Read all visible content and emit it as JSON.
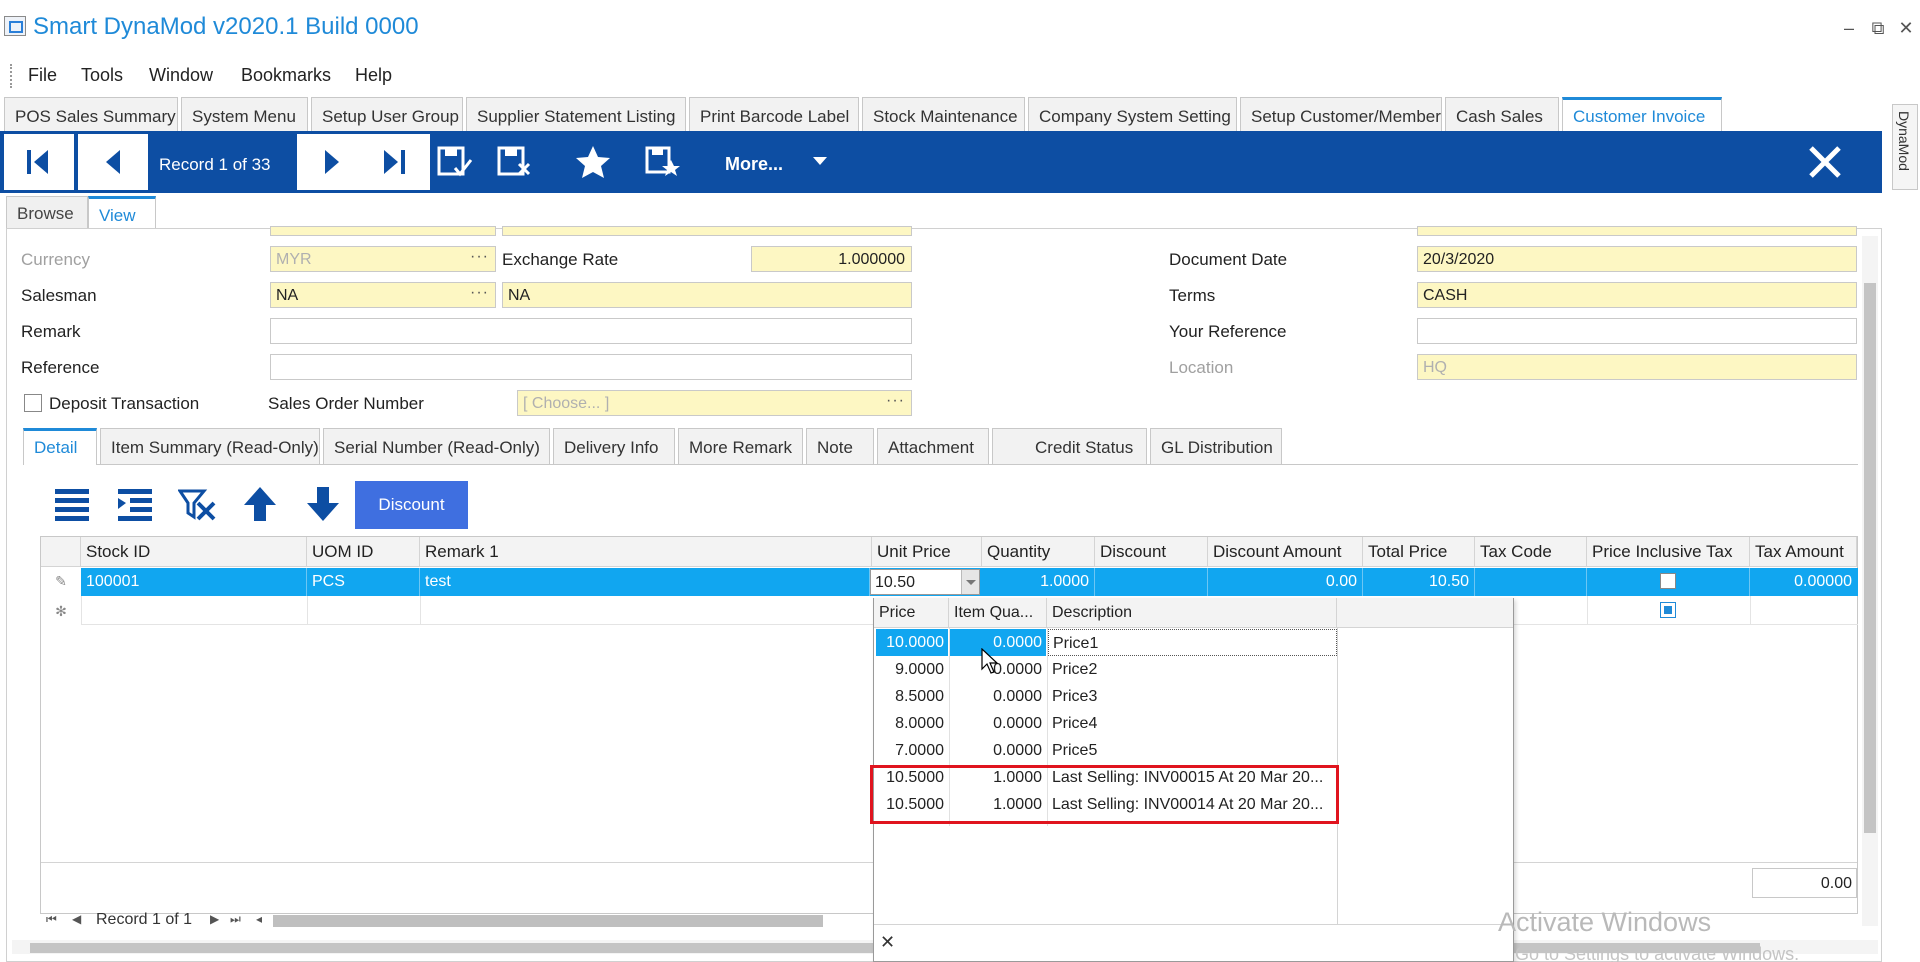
{
  "app": {
    "title": "Smart DynaMod v2020.1 Build 0000"
  },
  "window_controls": {
    "minimize": "–",
    "restore": "⧉",
    "close": "✕"
  },
  "menu": [
    "File",
    "Tools",
    "Window",
    "Bookmarks",
    "Help"
  ],
  "doc_tabs": [
    "POS Sales Summary",
    "System Menu",
    "Setup User Group",
    "Supplier Statement Listing",
    "Print Barcode Label",
    "Stock Maintenance",
    "Company System Setting",
    "Setup Customer/Member",
    "Cash Sales",
    "Customer Invoice"
  ],
  "side_tab": "DynaMod",
  "toolbar": {
    "record_label": "Record 1 of 33",
    "more_label": "More..."
  },
  "view_tabs": [
    "Browse",
    "View"
  ],
  "form": {
    "currency_label": "Currency",
    "currency_value": "MYR",
    "exchange_rate_label": "Exchange Rate",
    "exchange_rate_value": "1.000000",
    "salesman_label": "Salesman",
    "salesman_value": "NA",
    "salesman_name": "NA",
    "remark_label": "Remark",
    "remark_value": "",
    "reference_label": "Reference",
    "reference_value": "",
    "deposit_label": "Deposit Transaction",
    "sales_order_label": "Sales Order Number",
    "sales_order_placeholder": "[ Choose... ]",
    "document_date_label": "Document Date",
    "document_date_value": "20/3/2020",
    "terms_label": "Terms",
    "terms_value": "CASH",
    "your_reference_label": "Your Reference",
    "your_reference_value": "",
    "location_label": "Location",
    "location_value": "HQ"
  },
  "detail_tabs": [
    "Detail",
    "Item Summary (Read-Only)",
    "Serial Number (Read-Only)",
    "Delivery Info",
    "More Remark",
    "Note",
    "Attachment",
    "Credit Status",
    "GL Distribution"
  ],
  "discount_button": "Discount",
  "grid": {
    "columns": [
      "Stock ID",
      "UOM ID",
      "Remark 1",
      "Unit Price",
      "Quantity",
      "Discount",
      "Discount Amount",
      "Total Price",
      "Tax Code",
      "Price Inclusive Tax",
      "Tax Amount"
    ],
    "row": {
      "stock_id": "100001",
      "uom_id": "PCS",
      "remark1": "test",
      "unit_price": "10.50",
      "quantity": "1.0000",
      "discount": "",
      "discount_amount": "0.00",
      "total_price": "10.50",
      "tax_code": "",
      "price_inclusive_tax": false,
      "tax_amount": "0.00000"
    },
    "footer_total": "0.00",
    "nav_label": "Record 1 of 1"
  },
  "price_popup": {
    "columns": [
      "Price",
      "Item Qua...",
      "Description"
    ],
    "rows": [
      {
        "price": "10.0000",
        "qty": "0.0000",
        "desc": "Price1"
      },
      {
        "price": "9.0000",
        "qty": "0.0000",
        "desc": "Price2"
      },
      {
        "price": "8.5000",
        "qty": "0.0000",
        "desc": "Price3"
      },
      {
        "price": "8.0000",
        "qty": "0.0000",
        "desc": "Price4"
      },
      {
        "price": "7.0000",
        "qty": "0.0000",
        "desc": "Price5"
      },
      {
        "price": "10.5000",
        "qty": "1.0000",
        "desc": "Last Selling: INV00015 At 20 Mar 20..."
      },
      {
        "price": "10.5000",
        "qty": "1.0000",
        "desc": "Last Selling: INV00014 At 20 Mar 20..."
      }
    ],
    "close": "✕"
  },
  "watermark": {
    "line1": "Activate Windows",
    "line2": "Go to Settings to activate Windows."
  },
  "colors": {
    "accent": "#1f8ad8",
    "toolbar": "#0d4ea3",
    "selection": "#11a6f0",
    "field_yellow": "#fdf7c3",
    "highlight": "#e0141e"
  }
}
